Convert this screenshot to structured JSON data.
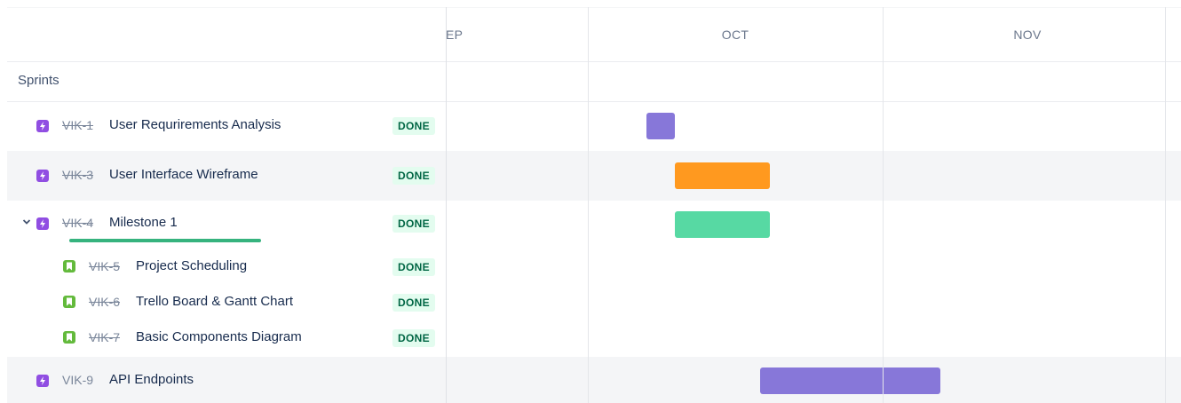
{
  "timeline": {
    "months": [
      "EP",
      "OCT",
      "NOV"
    ]
  },
  "sprints_label": "Sprints",
  "rows": [
    {
      "key": "VIK-1",
      "title": "User Requrirements Analysis",
      "status": "DONE",
      "type": "epic-icon",
      "bar_color": "#8777d9"
    },
    {
      "key": "VIK-3",
      "title": "User Interface Wireframe",
      "status": "DONE",
      "type": "epic-icon",
      "bar_color": "#ff991f"
    },
    {
      "key": "VIK-4",
      "title": "Milestone 1",
      "status": "DONE",
      "type": "epic-icon",
      "bar_color": "#57d9a3",
      "progress": 1.0
    },
    {
      "key": "VIK-5",
      "title": "Project Scheduling",
      "status": "DONE",
      "type": "story-icon"
    },
    {
      "key": "VIK-6",
      "title": "Trello Board & Gantt Chart",
      "status": "DONE",
      "type": "story-icon"
    },
    {
      "key": "VIK-7",
      "title": "Basic Components Diagram",
      "status": "DONE",
      "type": "story-icon"
    },
    {
      "key": "VIK-9",
      "title": "API Endpoints",
      "status": "",
      "type": "epic-icon",
      "bar_color": "#8777d9"
    }
  ],
  "colors": {
    "epic": "#904ee2",
    "story": "#63ba3c",
    "done_text": "#006644",
    "done_bg": "#e3fcef",
    "progress": "#36b37e"
  }
}
